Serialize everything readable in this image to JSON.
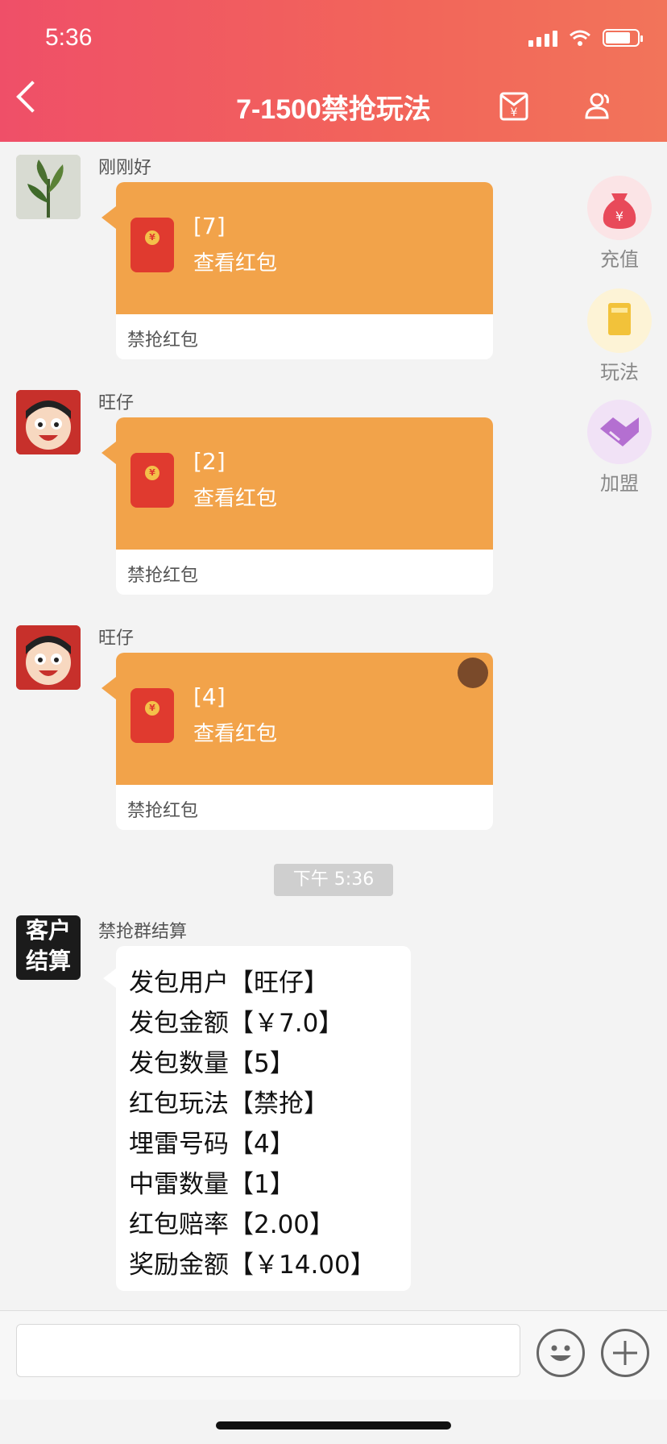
{
  "status": {
    "time": "5:36",
    "battery_level": 0.8
  },
  "header": {
    "title": "7-1500禁抢玩法"
  },
  "messages": [
    {
      "sender": "刚刚好",
      "num": "[7]",
      "view": "查看红包",
      "foot": "禁抢红包"
    },
    {
      "sender": "旺仔",
      "num": "[2]",
      "view": "查看红包",
      "foot": "禁抢红包"
    },
    {
      "sender": "旺仔",
      "num": "[4]",
      "view": "查看红包",
      "foot": "禁抢红包"
    }
  ],
  "side_buttons": [
    {
      "label": "充值",
      "icon": "money-bag-icon",
      "color": "#e84a5a"
    },
    {
      "label": "玩法",
      "icon": "rulebook-icon",
      "color": "#f2c23a"
    },
    {
      "label": "加盟",
      "icon": "handshake-icon",
      "color": "#b46fd1"
    }
  ],
  "divider": {
    "text": "下午 5:36"
  },
  "settlement": {
    "avatar_text_1": "客户",
    "avatar_text_2": "结算",
    "sender": "禁抢群结算",
    "lines": [
      "发包用户【旺仔】",
      "发包金额【￥7.0】",
      "发包数量【5】",
      "红包玩法【禁抢】",
      "埋雷号码【4】",
      "中雷数量【1】",
      "红包赔率【2.00】",
      "奖励金额【￥14.00】"
    ]
  },
  "colors": {
    "header_start": "#ef4f68",
    "header_end": "#f2745a",
    "envelope_card": "#f2a34a",
    "envelope": "#e03a2f"
  }
}
